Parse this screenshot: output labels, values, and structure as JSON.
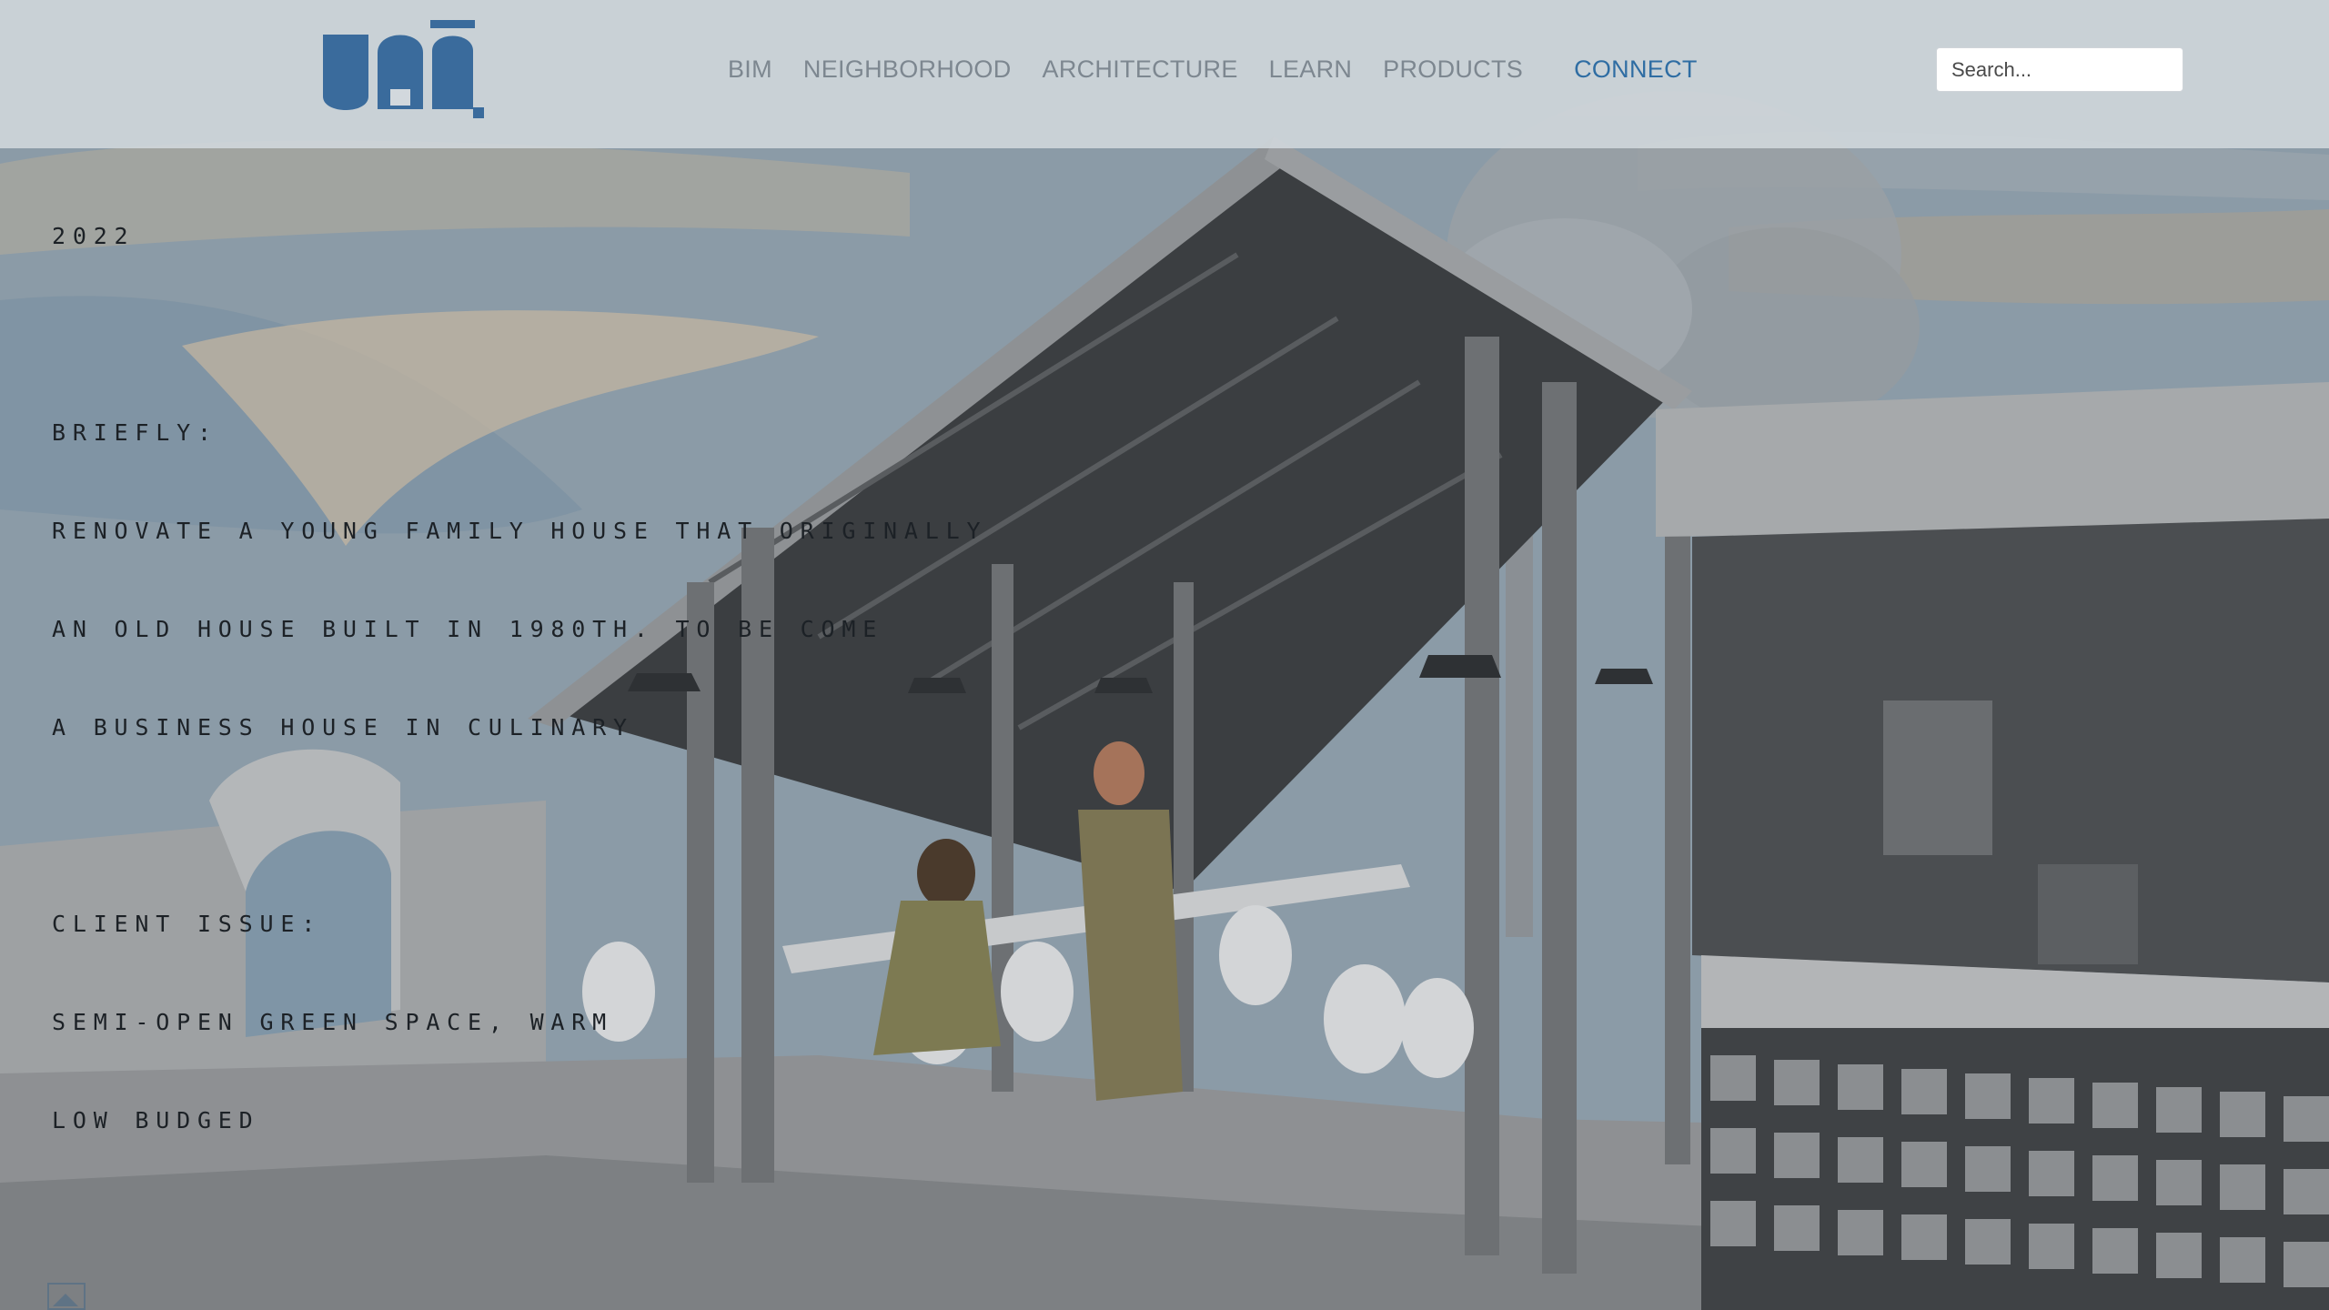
{
  "header": {
    "logo_alt": "ua logo",
    "nav": [
      {
        "label": "BIM"
      },
      {
        "label": "NEIGHBORHOOD"
      },
      {
        "label": "ARCHITECTURE"
      },
      {
        "label": "LEARN"
      },
      {
        "label": "PRODUCTS"
      }
    ],
    "cta_label": "CONNECT",
    "search": {
      "placeholder": "Search...",
      "value": ""
    }
  },
  "brief": {
    "year": "2022",
    "briefly_heading": "BRIEFLY:",
    "briefly_lines": [
      "RENOVATE A YOUNG FAMILY HOUSE THAT ORIGINALLY",
      "AN OLD HOUSE BUILT IN 1980TH. TO BE COME",
      "A BUSINESS HOUSE IN CULINARY"
    ],
    "issue_heading": "CLIENT ISSUE:",
    "issue_lines": [
      "SEMI-OPEN GREEN SPACE, WARM",
      "LOW BUDGED"
    ]
  },
  "colors": {
    "brand_blue": "#3a6b9c",
    "connect_blue": "#2f6da3",
    "nav_gray": "#7d8790",
    "header_bg": "#d2d8dd",
    "sky": "#8c9eab",
    "sand": "#c6b8a3"
  },
  "icons": {
    "logo": "ua-logo",
    "slide_thumb": "image-thumbnail-icon"
  }
}
